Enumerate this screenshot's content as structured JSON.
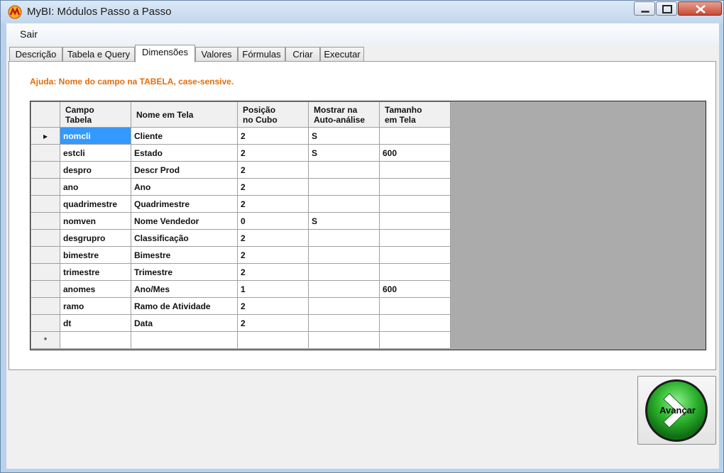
{
  "window": {
    "title": "MyBI: Módulos Passo a Passo"
  },
  "menu": {
    "items": [
      "Sair"
    ]
  },
  "tabs": [
    "Descrição",
    "Tabela e Query",
    "Dimensões",
    "Valores",
    "Fórmulas",
    "Criar",
    "Executar"
  ],
  "active_tab": "Dimensões",
  "help": "Ajuda: Nome do campo na TABELA, case-sensive.",
  "grid": {
    "columns": [
      [
        "Campo",
        "Tabela"
      ],
      [
        "Nome em Tela",
        ""
      ],
      [
        "Posição",
        "no Cubo"
      ],
      [
        "Mostrar na",
        "Auto-análise"
      ],
      [
        "Tamanho",
        "em Tela"
      ]
    ],
    "rows": [
      [
        "nomcli",
        "Cliente",
        "2",
        "S",
        ""
      ],
      [
        "estcli",
        "Estado",
        "2",
        "S",
        "600"
      ],
      [
        "despro",
        "Descr Prod",
        "2",
        "",
        ""
      ],
      [
        "ano",
        "Ano",
        "2",
        "",
        ""
      ],
      [
        "quadrimestre",
        "Quadrimestre",
        "2",
        "",
        ""
      ],
      [
        "nomven",
        "Nome Vendedor",
        "0",
        "S",
        ""
      ],
      [
        "desgrupro",
        "Classificação",
        "2",
        "",
        ""
      ],
      [
        "bimestre",
        "Bimestre",
        "2",
        "",
        ""
      ],
      [
        "trimestre",
        "Trimestre",
        "2",
        "",
        ""
      ],
      [
        "anomes",
        "Ano/Mes",
        "1",
        "",
        "600"
      ],
      [
        "ramo",
        "Ramo de Atividade",
        "2",
        "",
        ""
      ],
      [
        "dt",
        "Data",
        "2",
        "",
        ""
      ]
    ],
    "current_row_marker": "▸",
    "new_row_marker": "*"
  },
  "advance_button": {
    "label": "Avançar"
  },
  "colors": {
    "help_text": "#e46c0a",
    "selection": "#3399ff",
    "advance_green": "#2fb52f"
  }
}
